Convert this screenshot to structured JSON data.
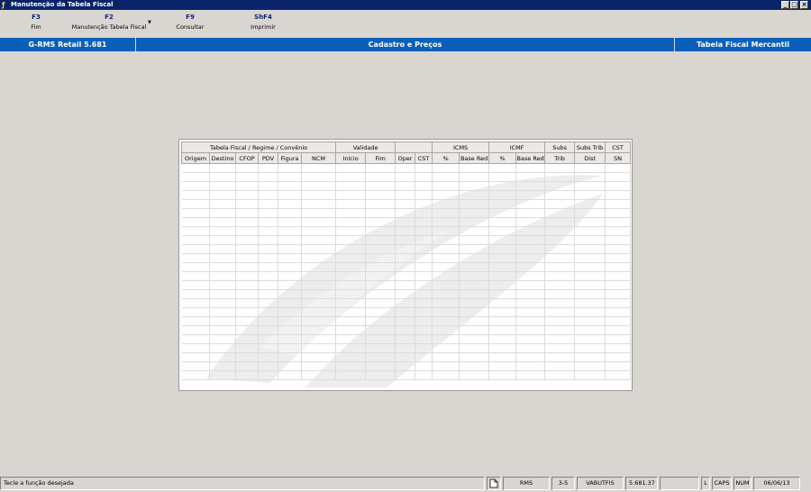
{
  "window": {
    "title": "Manutenção da Tabela Fiscal",
    "buttons": [
      "_",
      "□",
      "×"
    ]
  },
  "toolbar": [
    {
      "key": "F3",
      "label": "Fim"
    },
    {
      "key": "F2",
      "label": "Manutenção Tabela Fiscal"
    },
    {
      "key": "F9",
      "label": "Consultar"
    },
    {
      "key": "ShF4",
      "label": "Imprimir"
    }
  ],
  "header": {
    "app": "G-RMS Retail 5.681",
    "module": "Cadastro e Preços",
    "screen": "Tabela Fiscal Mercantil"
  },
  "grid": {
    "groups": [
      "Tabela Fiscal / Regime / Convênio",
      "Validade",
      "",
      "ICMS",
      "ICMF",
      "Subs",
      "Subs Trib",
      "CST"
    ],
    "columns": [
      "Origem",
      "Destino",
      "CFOP",
      "PDV",
      "Figura",
      "NCM",
      "Início",
      "Fim",
      "Oper",
      "CST",
      "%",
      "Base Red",
      "%",
      "Base Red",
      "Trib",
      "Dist",
      "SN"
    ]
  },
  "status": {
    "message": "Tecle a função desejada",
    "system": "RMS",
    "code": "3-5",
    "user": "VABUTFIS",
    "version": "5.681.37",
    "mode": "L",
    "caps": "CAPS",
    "num": "NUM",
    "date": "06/06/13"
  }
}
